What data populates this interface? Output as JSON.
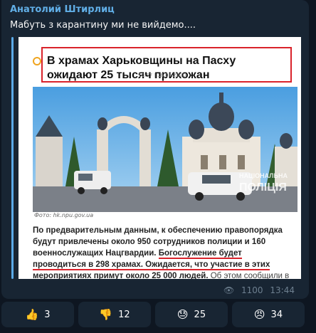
{
  "message": {
    "author": "Анатолий Штирлиц",
    "caption": "Мабуть з карантину ми не вийдемо....",
    "views": "1100",
    "time": "13:44"
  },
  "article": {
    "headline": "В храмах Харьковщины на Пасху ожидают 25 тысяч прихожан",
    "meta": "10:57 | 16.04.2020",
    "watermark_line1": "НАЦІОНАЛЬНА",
    "watermark_line2": "ПОЛІЦІЯ",
    "photo_credit": "Фото: hk.npu.gov.ua",
    "body_part1": "По предварительным данным, к обеспечению правопорядка будут привлечены около 950 сотрудников полиции и 160 военнослужащих Нацгвардии. ",
    "body_part2": "Богослужение будет проводиться в 298 храмах. Ожидается, что участие в этих мероприятиях примут около 25 000 людей.",
    "body_part3": " Об этом сообщили в отделе коммуникации"
  },
  "reactions": [
    {
      "icon": "thumbs-up",
      "emoji": "👍",
      "count": "3"
    },
    {
      "icon": "thumbs-down",
      "emoji": "👎",
      "count": "12"
    },
    {
      "icon": "tired-face",
      "emoji": "😓",
      "count": "25"
    },
    {
      "icon": "angry-face",
      "emoji": "😠",
      "count": "34"
    }
  ],
  "colors": {
    "background": "#0e1621",
    "bubble": "#182533",
    "author": "#61afe7",
    "highlight_red": "#d9232b"
  }
}
